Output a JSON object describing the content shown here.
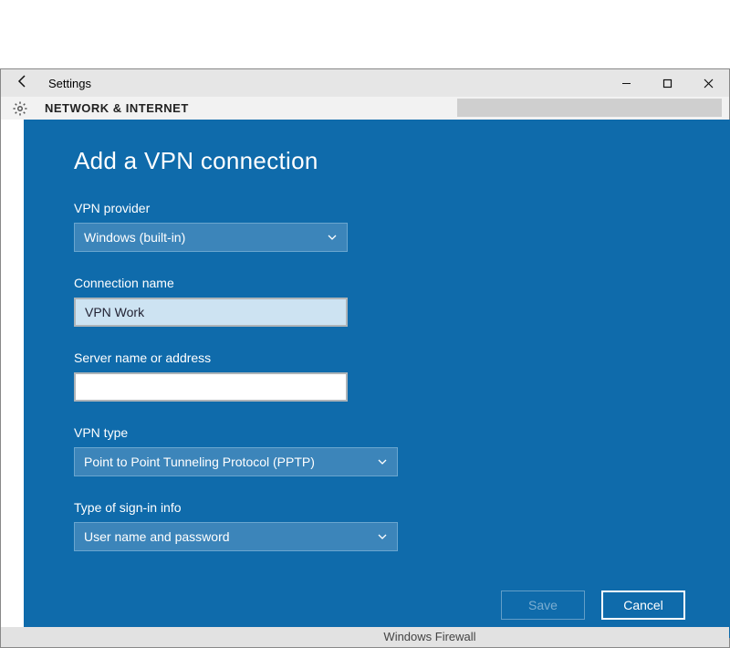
{
  "window": {
    "title": "Settings",
    "breadcrumb": "NETWORK & INTERNET"
  },
  "modal": {
    "title": "Add a VPN connection",
    "fields": {
      "vpn_provider": {
        "label": "VPN provider",
        "value": "Windows (built-in)"
      },
      "connection_name": {
        "label": "Connection name",
        "value": "VPN Work"
      },
      "server": {
        "label": "Server name or address",
        "value": ""
      },
      "vpn_type": {
        "label": "VPN type",
        "value": "Point to Point Tunneling Protocol (PPTP)"
      },
      "signin": {
        "label": "Type of sign-in info",
        "value": "User name and password"
      }
    },
    "buttons": {
      "save": "Save",
      "cancel": "Cancel"
    }
  },
  "footer": {
    "firewall": "Windows Firewall"
  }
}
